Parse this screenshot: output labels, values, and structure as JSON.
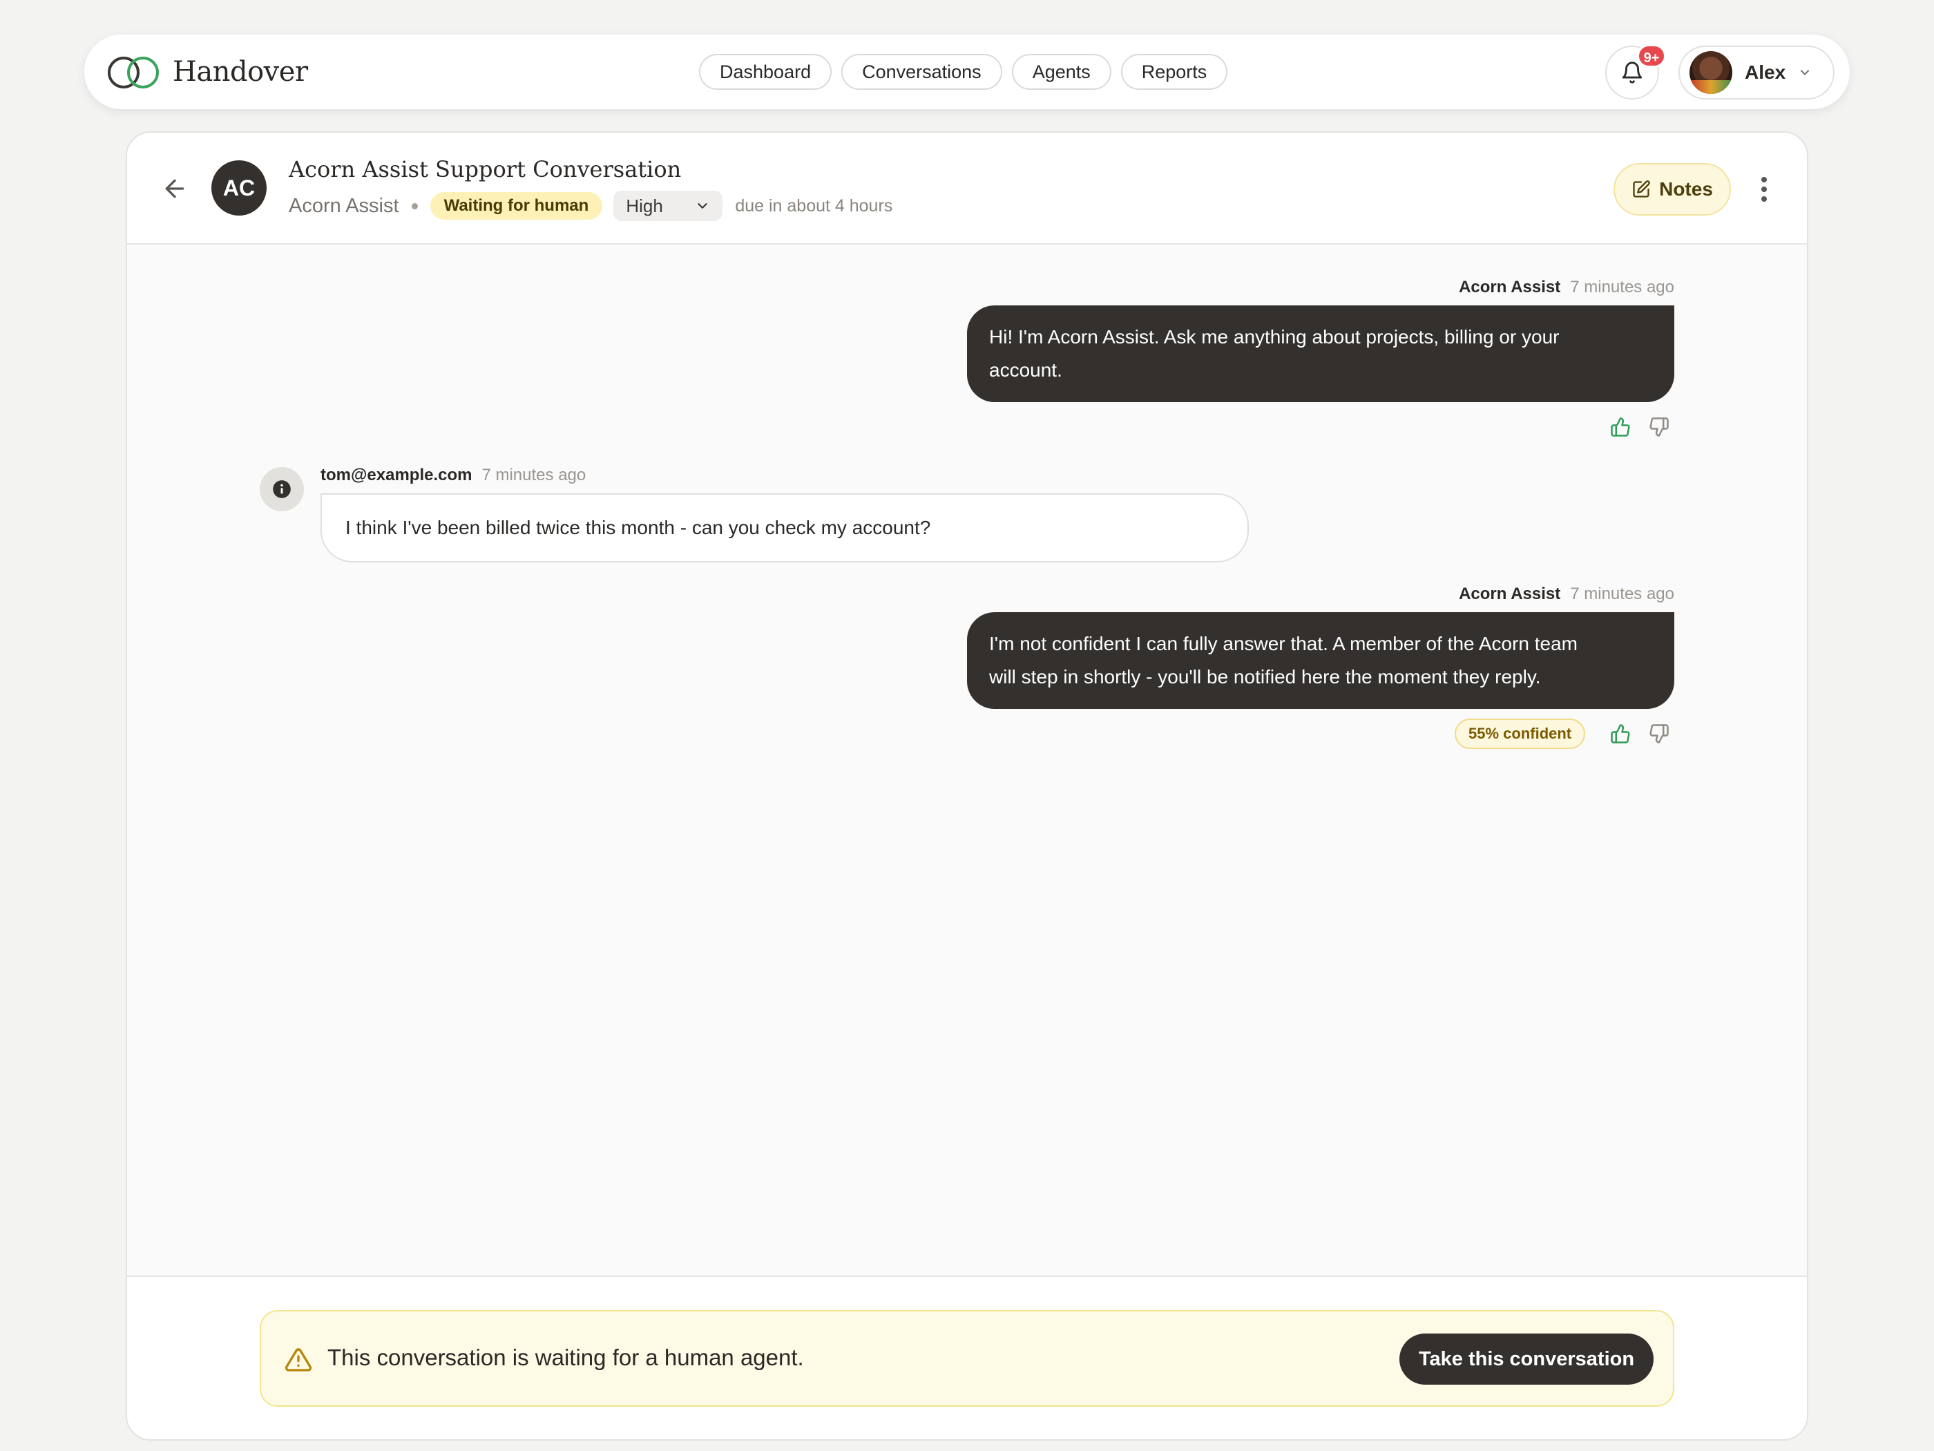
{
  "app": {
    "name": "Handover",
    "nav_tabs": [
      {
        "label": "Dashboard"
      },
      {
        "label": "Conversations"
      },
      {
        "label": "Agents"
      },
      {
        "label": "Reports"
      }
    ],
    "notifications_badge": "9+",
    "user_name": "Alex"
  },
  "conversation": {
    "avatar_initials": "AC",
    "title": "Acorn Assist Support Conversation",
    "agent": "Acorn Assist",
    "status": "Waiting for human",
    "priority": "High",
    "due": "due in about 4 hours",
    "notes_label": "Notes"
  },
  "messages": [
    {
      "sender": "Acorn Assist",
      "time": "7 minutes ago",
      "lines": [
        "Hi! I'm Acorn Assist. Ask me anything about projects, billing or your",
        "account."
      ],
      "feedback": "thumbs-up"
    },
    {
      "sender": "tom@example.com",
      "time": "7 minutes ago",
      "lines": [
        "I think I've been billed twice this month - can you check my account?"
      ]
    },
    {
      "sender": "Acorn Assist",
      "time": "7 minutes ago",
      "lines": [
        "I'm not confident I can fully answer that. A member of the Acorn team",
        "will step in shortly - you'll be notified here the moment they reply."
      ],
      "confidence": "55% confident",
      "feedback": "thumbs-up"
    }
  ],
  "footer": {
    "banner_text": "This conversation is waiting for a human agent.",
    "take_label": "Take this conversation"
  },
  "colors": {
    "accent_green": "#3aa35c",
    "dark_bubble": "#34302d",
    "status_yellow": "#fdf1b8",
    "badge_red": "#e5484d"
  },
  "icons": [
    "brand-logo",
    "bell-icon",
    "chevron-down-icon",
    "arrow-left-icon",
    "edit-icon",
    "more-vertical-icon",
    "thumbs-up-icon",
    "thumbs-down-icon",
    "info-icon",
    "warning-icon"
  ]
}
